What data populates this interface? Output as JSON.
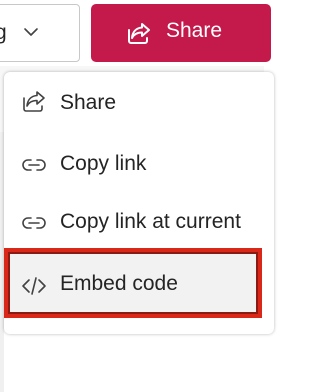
{
  "toolbar": {
    "view_dropdown_visible_text": "g",
    "share_label": "Share"
  },
  "share_menu": {
    "items": [
      {
        "label": "Share",
        "icon": "share-icon"
      },
      {
        "label": "Copy link",
        "icon": "link-icon"
      },
      {
        "label": "Copy link at current",
        "icon": "link-icon"
      },
      {
        "label": "Embed code",
        "icon": "code-icon"
      }
    ],
    "highlighted_item": "Embed code"
  },
  "colors": {
    "share_button_bg": "#c4194b",
    "highlight_border": "#d9271a"
  }
}
